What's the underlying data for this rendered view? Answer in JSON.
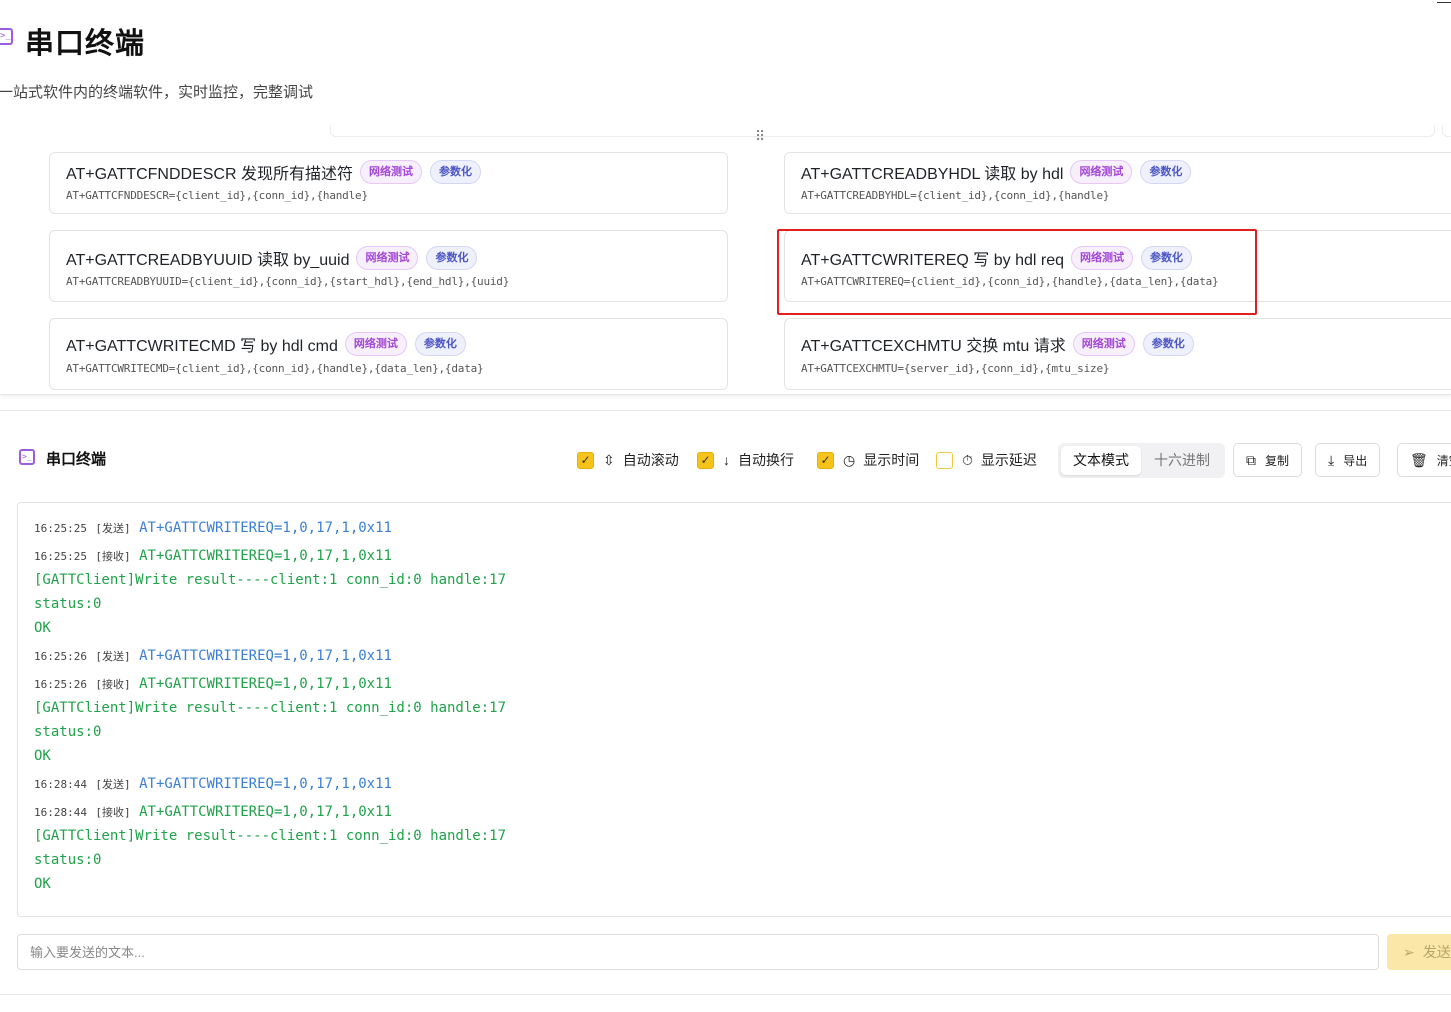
{
  "header": {
    "title": "串口终端",
    "subtitle": "一站式软件内的终端软件，实时监控，完整调试"
  },
  "commands": [
    {
      "title": "AT+GATTCFNDDESCR 发现所有描述符",
      "tags": [
        "网络测试",
        "参数化"
      ],
      "cmd": "AT+GATTCFNDDESCR={client_id},{conn_id},{handle}"
    },
    {
      "title": "AT+GATTCREADBYHDL 读取 by hdl",
      "tags": [
        "网络测试",
        "参数化"
      ],
      "cmd": "AT+GATTCREADBYHDL={client_id},{conn_id},{handle}"
    },
    {
      "title": "AT+GATTCREADBYUUID 读取 by_uuid",
      "tags": [
        "网络测试",
        "参数化"
      ],
      "cmd": "AT+GATTCREADBYUUID={client_id},{conn_id},{start_hdl},{end_hdl},{uuid}"
    },
    {
      "title": "AT+GATTCWRITEREQ 写 by hdl req",
      "tags": [
        "网络测试",
        "参数化"
      ],
      "cmd": "AT+GATTCWRITEREQ={client_id},{conn_id},{handle},{data_len},{data}"
    },
    {
      "title": "AT+GATTCWRITECMD 写 by hdl cmd",
      "tags": [
        "网络测试",
        "参数化"
      ],
      "cmd": "AT+GATTCWRITECMD={client_id},{conn_id},{handle},{data_len},{data}"
    },
    {
      "title": "AT+GATTCEXCHMTU 交换 mtu 请求",
      "tags": [
        "网络测试",
        "参数化"
      ],
      "cmd": "AT+GATTCEXCHMTU={server_id},{conn_id},{mtu_size}"
    }
  ],
  "terminal": {
    "title": "串口终端",
    "options": {
      "auto_scroll": {
        "label": "自动滚动",
        "checked": true
      },
      "auto_wrap": {
        "label": "自动换行",
        "checked": true
      },
      "show_time": {
        "label": "显示时间",
        "checked": true
      },
      "show_delay": {
        "label": "显示延迟",
        "checked": false
      }
    },
    "modes": {
      "text": "文本模式",
      "hex": "十六进制",
      "active": "text"
    },
    "buttons": {
      "copy": "复制",
      "export": "导出",
      "clear": "清空"
    },
    "lines": [
      {
        "time": "16:25:25",
        "dir": "[发送]",
        "text": "AT+GATTCWRITEREQ=1,0,17,1,0x11",
        "kind": "sent"
      },
      {
        "time": "16:25:25",
        "dir": "[接收]",
        "text": "AT+GATTCWRITEREQ=1,0,17,1,0x11",
        "kind": "recv"
      },
      {
        "time": "",
        "dir": "",
        "text": "[GATTClient]Write result----client:1 conn_id:0 handle:17",
        "kind": "recv"
      },
      {
        "time": "",
        "dir": "",
        "text": "status:0",
        "kind": "recv"
      },
      {
        "time": "",
        "dir": "",
        "text": "OK",
        "kind": "recv"
      },
      {
        "time": "16:25:26",
        "dir": "[发送]",
        "text": "AT+GATTCWRITEREQ=1,0,17,1,0x11",
        "kind": "sent"
      },
      {
        "time": "16:25:26",
        "dir": "[接收]",
        "text": "AT+GATTCWRITEREQ=1,0,17,1,0x11",
        "kind": "recv"
      },
      {
        "time": "",
        "dir": "",
        "text": "[GATTClient]Write result----client:1 conn_id:0 handle:17",
        "kind": "recv"
      },
      {
        "time": "",
        "dir": "",
        "text": "status:0",
        "kind": "recv"
      },
      {
        "time": "",
        "dir": "",
        "text": "OK",
        "kind": "recv"
      },
      {
        "time": "16:28:44",
        "dir": "[发送]",
        "text": "AT+GATTCWRITEREQ=1,0,17,1,0x11",
        "kind": "sent"
      },
      {
        "time": "16:28:44",
        "dir": "[接收]",
        "text": "AT+GATTCWRITEREQ=1,0,17,1,0x11",
        "kind": "recv"
      },
      {
        "time": "",
        "dir": "",
        "text": "[GATTClient]Write result----client:1 conn_id:0 handle:17",
        "kind": "recv"
      },
      {
        "time": "",
        "dir": "",
        "text": "status:0",
        "kind": "recv"
      },
      {
        "time": "",
        "dir": "",
        "text": "OK",
        "kind": "recv"
      }
    ],
    "input_placeholder": "输入要发送的文本...",
    "send_label": "发送"
  },
  "colors": {
    "accent": "#f6c31b",
    "sent_text": "#3a7fd5",
    "recv_text": "#20a24a",
    "highlight_border": "#e02020",
    "tag_net": "#a347d6",
    "tag_param": "#4b56c4"
  }
}
